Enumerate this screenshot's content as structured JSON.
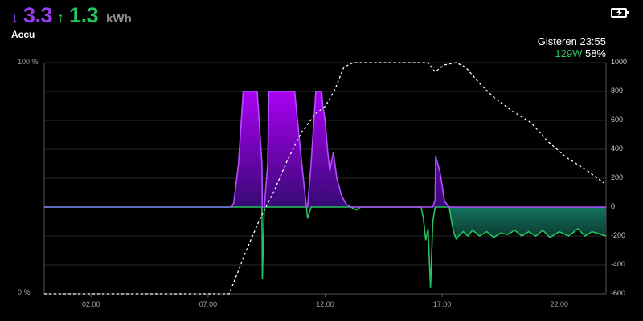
{
  "header": {
    "import_arrow": "↓",
    "import_value": "3.3",
    "export_arrow": "↑",
    "export_value": "1.3",
    "unit": "kWh",
    "title": "Accu"
  },
  "status": {
    "label": "Gisteren 23:55",
    "power": "129W",
    "percent": "58%"
  },
  "colors": {
    "import": "#9b3cf0",
    "export": "#22c55e",
    "background": "#000000"
  },
  "icons": {
    "battery": "battery-charging-icon"
  },
  "chart_data": {
    "type": "area",
    "x_ticks": [
      "02:00",
      "07:00",
      "12:00",
      "17:00",
      "22:00"
    ],
    "x_range_hours": [
      0,
      24
    ],
    "y_ticks": [
      "1000",
      "800",
      "600",
      "400",
      "200",
      "0",
      "-200",
      "-400",
      "-600"
    ],
    "ylim": [
      -600,
      1000
    ],
    "soc_ticks": [
      "100 %",
      "0 %"
    ],
    "grid": true,
    "series": [
      {
        "kind": "power",
        "x": [
          0,
          8,
          8.1,
          8.3,
          8.5,
          8.9,
          9.1,
          9.3,
          9.32,
          9.4,
          9.55,
          9.6,
          9.8,
          10.2,
          10.5,
          10.7,
          11.0,
          11.2,
          11.25,
          11.4,
          11.6,
          11.85,
          11.9,
          12.0,
          12.1,
          12.2,
          12.35,
          12.5,
          12.7,
          12.9,
          13.1,
          13.35,
          13.5,
          13.8,
          14.0,
          14.2,
          16.1,
          16.2,
          16.3,
          16.4,
          16.5,
          16.6,
          16.7,
          16.72,
          16.9,
          17.0,
          17.1,
          17.3,
          17.4,
          17.5,
          17.6,
          17.7,
          17.9,
          18.1,
          18.3,
          18.6,
          18.9,
          19.2,
          19.5,
          19.8,
          20.1,
          20.4,
          20.7,
          21.0,
          21.3,
          21.6,
          22.0,
          22.4,
          22.8,
          23.1,
          23.4,
          23.8,
          24.0
        ],
        "y": [
          0,
          0,
          30,
          300,
          800,
          800,
          800,
          300,
          -500,
          0,
          300,
          800,
          800,
          800,
          800,
          800,
          300,
          0,
          -80,
          300,
          800,
          800,
          700,
          600,
          400,
          250,
          380,
          200,
          80,
          20,
          0,
          -20,
          0,
          0,
          0,
          0,
          0,
          -80,
          -230,
          -150,
          -560,
          -100,
          50,
          350,
          250,
          150,
          40,
          0,
          -100,
          -180,
          -220,
          -200,
          -170,
          -200,
          -160,
          -200,
          -170,
          -210,
          -180,
          -190,
          -160,
          -200,
          -170,
          -200,
          -160,
          -210,
          -170,
          -200,
          -150,
          -200,
          -170,
          -190,
          -200
        ]
      },
      {
        "kind": "state_of_charge_percent",
        "x": [
          0,
          7.9,
          8.3,
          8.6,
          9.2,
          9.8,
          10.4,
          11.0,
          11.6,
          12.0,
          12.4,
          12.8,
          13.2,
          14.0,
          15.0,
          16.4,
          16.7,
          17.1,
          17.6,
          18.0,
          18.6,
          19.2,
          20.0,
          20.8,
          21.5,
          22.3,
          23.1,
          23.9
        ],
        "y": [
          0,
          0,
          10,
          18,
          32,
          44,
          58,
          70,
          78,
          81,
          88,
          98,
          100,
          100,
          100,
          100,
          96,
          99,
          100,
          98,
          91,
          85,
          79,
          74,
          66,
          59,
          54,
          48
        ]
      }
    ]
  }
}
